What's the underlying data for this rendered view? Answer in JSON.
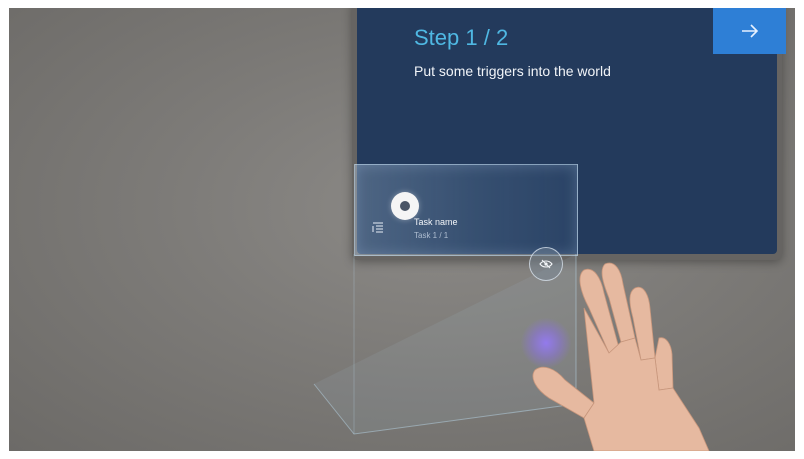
{
  "tutorial": {
    "step_title": "Step 1 / 2",
    "step_description": "Put some triggers into the world",
    "next_icon": "arrow-right-icon"
  },
  "task_card": {
    "name": "Task name",
    "progress": "Task 1 / 1",
    "list_icon": "task-list-icon",
    "hide_icon": "eye-hide-icon"
  },
  "colors": {
    "panel": "#233a5c",
    "accent_title": "#4fb8e3",
    "next_button": "#2e7fd6"
  }
}
